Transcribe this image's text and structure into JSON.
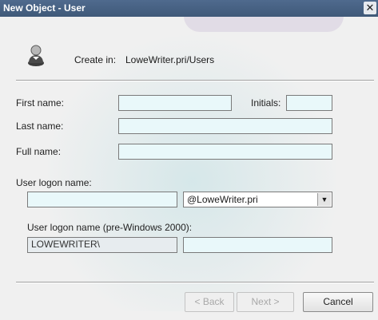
{
  "window": {
    "title": "New Object - User",
    "close_glyph": "✕"
  },
  "header": {
    "icon": "user-icon",
    "create_in_label": "Create in:",
    "create_in_path": "LoweWriter.pri/Users"
  },
  "form": {
    "first_name_label": "First name:",
    "first_name_value": "",
    "initials_label": "Initials:",
    "initials_value": "",
    "last_name_label": "Last name:",
    "last_name_value": "",
    "full_name_label": "Full name:",
    "full_name_value": "",
    "logon_name_label": "User logon name:",
    "logon_name_value": "",
    "domain_selected": "@LoweWriter.pri",
    "pre2000_label": "User logon name (pre-Windows 2000):",
    "pre2000_domain": "LOWEWRITER\\",
    "pre2000_value": ""
  },
  "buttons": {
    "back": "< Back",
    "next": "Next >",
    "cancel": "Cancel"
  }
}
